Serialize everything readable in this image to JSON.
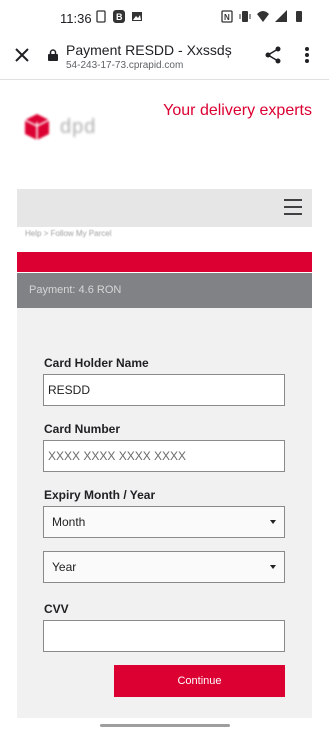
{
  "status_bar": {
    "time": "11:36",
    "left_icons": [
      "sim-icon",
      "b-app-icon",
      "image-icon"
    ],
    "right_icons": [
      "nfc-icon",
      "vibrate-icon",
      "wifi-icon",
      "signal-icon",
      "battery-icon"
    ]
  },
  "app_bar": {
    "title": "Payment RESDD - Xxssdș",
    "url": "54-243-17-73.cprapid.com",
    "icons": [
      "close-icon",
      "lock-icon",
      "share-icon",
      "more-vert-icon"
    ]
  },
  "site": {
    "logo_text": "dpd",
    "tagline": "Your delivery experts",
    "breadcrumb": "Help  >  Follow My Parcel",
    "payment_label": "Payment: 4.6 RON",
    "colors": {
      "brand_red": "#dc0032",
      "gray_bar": "#808285",
      "nav_bg": "#e6e6e6"
    }
  },
  "form": {
    "card_holder_label": "Card Holder Name",
    "card_holder_value": "RESDD",
    "card_number_label": "Card Number",
    "card_number_placeholder": "XXXX XXXX XXXX XXXX",
    "expiry_label": "Expiry Month / Year",
    "month_selected": "Month",
    "year_selected": "Year",
    "cvv_label": "CVV",
    "cvv_value": "",
    "continue_label": "Continue"
  }
}
